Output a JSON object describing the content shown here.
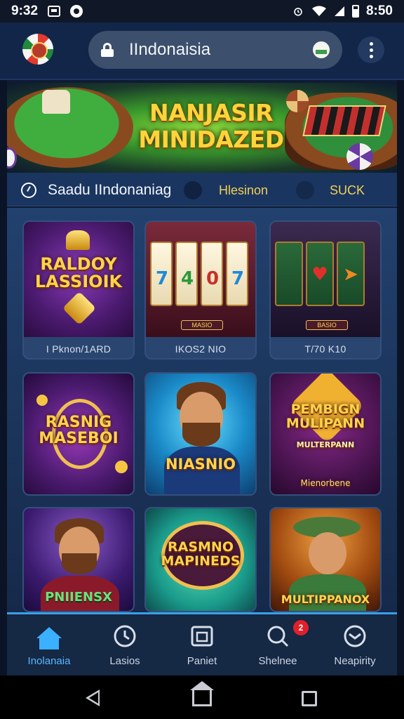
{
  "status_bar": {
    "time_left": "9:32",
    "time_right": "8:50"
  },
  "browser": {
    "url": "IIndonaisia"
  },
  "banner": {
    "title_line1": "NANJASIR",
    "title_line2": "MINIDAZED"
  },
  "filter_row": {
    "label_primary": "Saadu IIndonaniag",
    "label_secondary": "Hlesinon",
    "label_tertiary": "SUCK"
  },
  "games": [
    {
      "title": "RALDOY LASSIOIK",
      "caption": "I Pknon/1ARD"
    },
    {
      "title": "",
      "caption": "IKOS2 NIO",
      "plate": "MASIO"
    },
    {
      "title": "",
      "caption": "T/70 K10",
      "plate": "BASIO"
    },
    {
      "title": "RASNIG MASEBOI",
      "caption": ""
    },
    {
      "title": "NIASNIO",
      "caption": ""
    },
    {
      "title": "PEMBIGN MULIPANN",
      "subtitle": "MULTERPANN",
      "caption": "Mienorbene"
    },
    {
      "title": "PNIIENSX",
      "caption": ""
    },
    {
      "title": "RASMNO MAPINEDS",
      "caption": ""
    },
    {
      "title": "MULTIPPANOX",
      "caption": ""
    }
  ],
  "bottom_nav": {
    "items": [
      {
        "label": "Inolanaia",
        "icon": "home-icon",
        "active": true
      },
      {
        "label": "Lasios",
        "icon": "clock-icon",
        "active": false
      },
      {
        "label": "Paniet",
        "icon": "wallet-icon",
        "active": false
      },
      {
        "label": "Shelnee",
        "icon": "search-icon",
        "active": false,
        "badge": "2"
      },
      {
        "label": "Neapirity",
        "icon": "support-icon",
        "active": false
      }
    ]
  },
  "colors": {
    "accent_blue": "#3ab0ff",
    "gold_text": "#ffd34d",
    "badge_red": "#e0202a"
  }
}
